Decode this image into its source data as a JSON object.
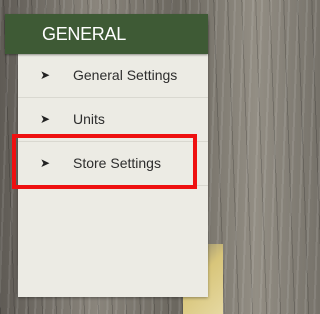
{
  "header": {
    "title": "GENERAL"
  },
  "menu": {
    "items": [
      {
        "label": "General Settings",
        "icon": "arrow-right-icon"
      },
      {
        "label": "Units",
        "icon": "arrow-right-icon"
      },
      {
        "label": "Store Settings",
        "icon": "arrow-right-icon"
      }
    ],
    "arrow_glyph": "➤"
  },
  "colors": {
    "header_bg": "#3e5a35",
    "panel_bg": "#ecebe4",
    "highlight": "#ee1010",
    "text": "#2d2d2d"
  }
}
